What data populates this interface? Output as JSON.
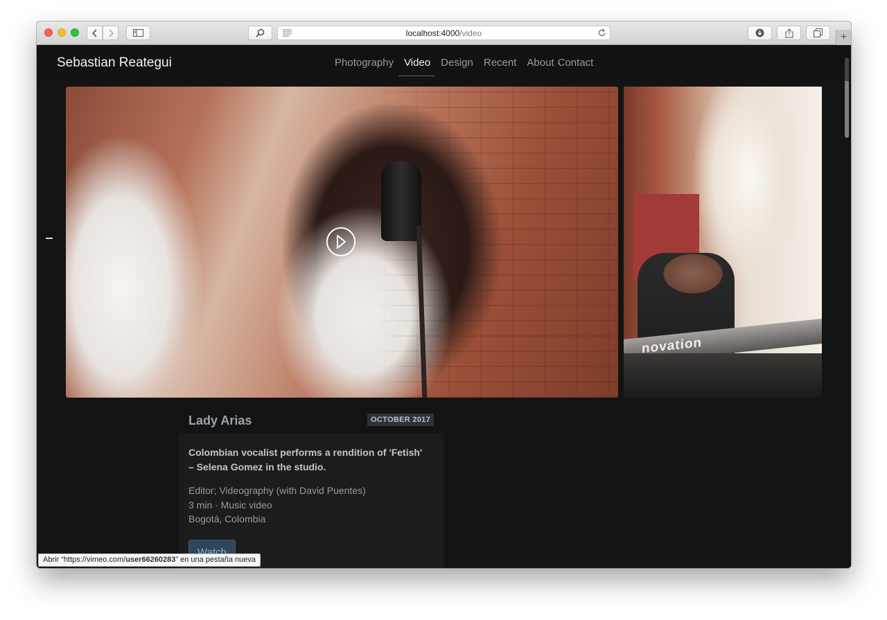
{
  "browser": {
    "url_host": "localhost:4000",
    "url_path": "/video",
    "status_prefix": "Abrir “https://vimeo.com/",
    "status_url": "user66260283",
    "status_suffix": "” en una pestaña nueva",
    "new_tab_label": "+"
  },
  "site": {
    "brand": "Sebastian Reategui",
    "nav": {
      "photography": "Photography",
      "video": "Video",
      "design": "Design",
      "recent": "Recent",
      "about": "About",
      "separator": "·",
      "contact": "Contact"
    }
  },
  "project": {
    "title": "Lady Arias",
    "date": "OCTOBER 2017",
    "description": "Colombian vocalist performs a rendition of 'Fetish' – Selena Gomez in the studio.",
    "role": "Editor; Videography (with David Puentes)",
    "duration_type": "3 min · Music video",
    "location": "Bogotá, Colombia",
    "watch_label": "Watch",
    "side_keyboard_brand": "novation"
  },
  "icons": [
    "back-icon",
    "forward-icon",
    "sidebar-icon",
    "search-icon",
    "reader-icon",
    "reload-icon",
    "download-icon",
    "share-icon",
    "tabs-icon",
    "play-icon"
  ]
}
